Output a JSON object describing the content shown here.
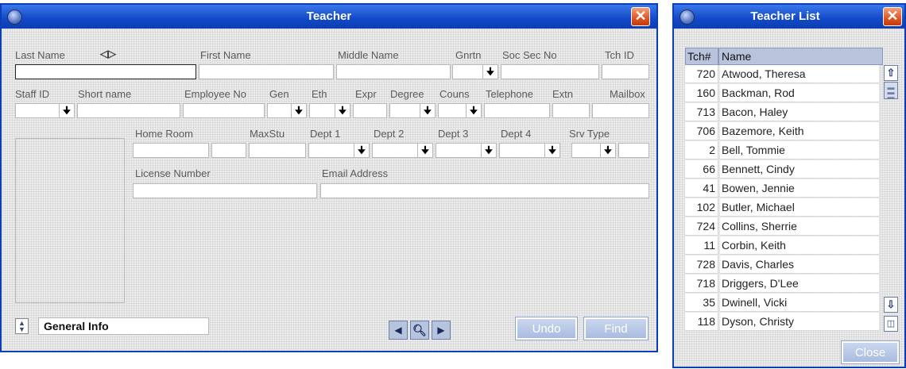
{
  "teacher_window": {
    "title": "Teacher",
    "close_glyph": "✕",
    "labels": {
      "last_name": "Last Name",
      "first_name": "First Name",
      "middle_name": "Middle Name",
      "gnrtn": "Gnrtn",
      "soc_sec_no": "Soc Sec No",
      "tch_id": "Tch ID",
      "staff_id": "Staff ID",
      "short_name": "Short name",
      "employee_no": "Employee No",
      "gen": "Gen",
      "eth": "Eth",
      "expr": "Expr",
      "degree": "Degree",
      "couns": "Couns",
      "telephone": "Telephone",
      "extn": "Extn",
      "mailbox": "Mailbox",
      "home_room": "Home Room",
      "max_stu": "MaxStu",
      "dept1": "Dept 1",
      "dept2": "Dept 2",
      "dept3": "Dept 3",
      "dept4": "Dept 4",
      "srv_type": "Srv Type",
      "license_number": "License Number",
      "email_address": "Email Address"
    },
    "dropdown_arrow": "🠋",
    "section_selector": "General Info",
    "buttons": {
      "undo": "Undo",
      "find": "Find"
    }
  },
  "teacher_list": {
    "title": "Teacher List",
    "close_glyph": "✕",
    "columns": [
      "Tch#",
      "Name"
    ],
    "rows": [
      {
        "num": "720",
        "name": "Atwood, Theresa"
      },
      {
        "num": "160",
        "name": "Backman, Rod"
      },
      {
        "num": "713",
        "name": "Bacon, Haley"
      },
      {
        "num": "706",
        "name": "Bazemore, Keith"
      },
      {
        "num": "2",
        "name": "Bell, Tommie"
      },
      {
        "num": "66",
        "name": "Bennett, Cindy"
      },
      {
        "num": "41",
        "name": "Bowen, Jennie"
      },
      {
        "num": "102",
        "name": "Butler, Michael"
      },
      {
        "num": "724",
        "name": "Collins, Sherrie"
      },
      {
        "num": "11",
        "name": "Corbin, Keith"
      },
      {
        "num": "728",
        "name": "Davis, Charles"
      },
      {
        "num": "718",
        "name": "Driggers, D'Lee"
      },
      {
        "num": "35",
        "name": "Dwinell, Vicki"
      },
      {
        "num": "118",
        "name": "Dyson, Christy"
      }
    ],
    "close_button": "Close"
  }
}
